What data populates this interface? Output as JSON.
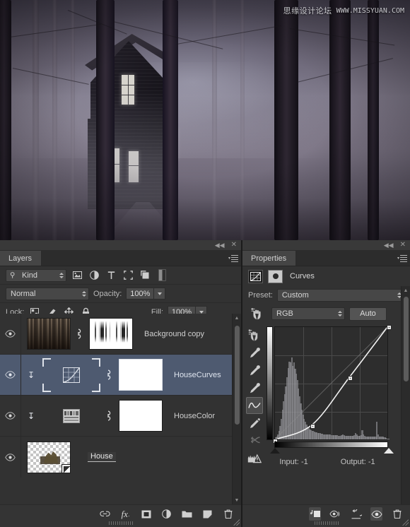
{
  "canvas": {
    "watermark_cn": "思缘设计论坛",
    "watermark_url": "WWW.MISSYUAN.COM",
    "scene_description": "Dark haunted wooden house in a foggy forest with bare tree trunks",
    "colors": {
      "sky": "#7e7888",
      "fog": "#a6a4b4",
      "house": "#1d1a22",
      "window": "#d6d3cc"
    }
  },
  "layers_panel": {
    "title": "Layers",
    "topbar": {
      "collapse_icon": "collapse-double-arrow-icon",
      "close_icon": "close-icon",
      "menu_icon": "panel-menu-icon"
    },
    "filter": {
      "kind_label": "Kind",
      "search_icon": "search-icon",
      "type_filters": [
        "pixel-layer-filter-icon",
        "adjustment-layer-filter-icon",
        "type-layer-filter-icon",
        "shape-layer-filter-icon",
        "smart-object-filter-icon"
      ],
      "toggle_icon": "filter-enable-toggle"
    },
    "blend": {
      "mode": "Normal",
      "opacity_label": "Opacity:",
      "opacity_value": "100%"
    },
    "lock": {
      "label": "Lock:",
      "icons": [
        "lock-transparent-pixels-icon",
        "lock-image-pixels-icon",
        "lock-position-icon",
        "lock-all-icon"
      ],
      "fill_label": "Fill:",
      "fill_value": "100%"
    },
    "layers": [
      {
        "name": "Background copy",
        "visible": true,
        "selected": false,
        "thumb_type": "forest",
        "has_mask": true,
        "mask_type": "strokes",
        "linked": true,
        "editing": false,
        "clipped": false
      },
      {
        "name": "HouseCurves",
        "visible": true,
        "selected": true,
        "thumb_type": "adjustment-curves",
        "has_mask": true,
        "mask_type": "white",
        "linked": true,
        "editing": false,
        "clipped": true
      },
      {
        "name": "HouseColor",
        "visible": true,
        "selected": false,
        "thumb_type": "adjustment-color-balance",
        "has_mask": true,
        "mask_type": "white",
        "linked": true,
        "editing": false,
        "clipped": true
      },
      {
        "name": "House",
        "visible": true,
        "selected": false,
        "thumb_type": "checker-house",
        "has_mask": false,
        "mask_type": "",
        "linked": false,
        "editing": true,
        "clipped": false
      }
    ],
    "bottom_icons": [
      "link-layers-icon",
      "add-layer-style-icon",
      "add-layer-mask-icon",
      "new-adjustment-layer-icon",
      "new-group-icon",
      "new-layer-icon",
      "delete-layer-icon"
    ],
    "scrollbar": {
      "up_arrow": "scroll-up-arrow",
      "down_arrow": "scroll-down-arrow"
    }
  },
  "properties_panel": {
    "title": "Properties",
    "topbar": {
      "collapse_icon": "collapse-double-arrow-icon",
      "close_icon": "close-icon",
      "menu_icon": "panel-menu-icon"
    },
    "adjustment_title": "Curves",
    "adjustment_icon": "curves-icon",
    "mask_icon": "pixel-mask-icon",
    "preset": {
      "label": "Preset:",
      "value": "Custom"
    },
    "channel": {
      "value": "RGB",
      "auto_label": "Auto",
      "targeted_adjust_icon": "on-image-adjust-icon"
    },
    "tools": [
      "on-image-adjustment-tool-icon",
      "black-point-eyedropper-icon",
      "gray-point-eyedropper-icon",
      "white-point-eyedropper-icon",
      "curve-point-tool-icon",
      "pencil-draw-curve-icon",
      "smooth-curve-icon",
      "clipping-warning-icon"
    ],
    "active_tool": "curve-point-tool-icon",
    "readout": {
      "input_label": "Input:",
      "input_value": "-1",
      "output_label": "Output:",
      "output_value": "-1"
    },
    "bottom_icons": [
      "clip-to-layer-icon",
      "toggle-layer-mask-icon",
      "reset-adjustment-icon",
      "toggle-layer-visibility-icon",
      "delete-adjustment-layer-icon"
    ],
    "active_bottom_icon": "clip-to-layer-icon"
  },
  "chart_data": {
    "type": "line",
    "title": "Curves (RGB)",
    "xlabel": "Input",
    "ylabel": "Output",
    "xlim": [
      0,
      255
    ],
    "ylim": [
      0,
      255
    ],
    "grid": true,
    "legend": "none",
    "gradient_bars": {
      "input_axis": "black-to-white-horizontal",
      "output_axis": "black-to-white-vertical"
    },
    "control_points": [
      {
        "input": 0,
        "output": 0
      },
      {
        "input": 84,
        "output": 33
      },
      {
        "input": 168,
        "output": 140
      },
      {
        "input": 255,
        "output": 255
      }
    ],
    "baseline": {
      "from": [
        0,
        0
      ],
      "to": [
        255,
        255
      ]
    },
    "endpoint_sliders": {
      "black_point": 0,
      "white_point": 255
    },
    "histogram_note": "Shadow-heavy histogram with a large peak near input 30-60 and small spikes near 195-225",
    "histogram": [
      4,
      6,
      10,
      16,
      26,
      40,
      58,
      74,
      88,
      104,
      122,
      140,
      152,
      150,
      160,
      143,
      150,
      138,
      128,
      116,
      100,
      84,
      70,
      58,
      48,
      40,
      34,
      29,
      25,
      22,
      20,
      18,
      17,
      16,
      15,
      14,
      14,
      13,
      12,
      12,
      11,
      11,
      10,
      10,
      10,
      9,
      9,
      9,
      9,
      8,
      8,
      8,
      8,
      8,
      8,
      7,
      7,
      7,
      8,
      10,
      8,
      7,
      7,
      7,
      7,
      7,
      7,
      7,
      7,
      8,
      12,
      9,
      7,
      7,
      7,
      8,
      18,
      10,
      7,
      6,
      6,
      6,
      6,
      6,
      6,
      6,
      6,
      6,
      6,
      34,
      10,
      6,
      5,
      5,
      5,
      4,
      4,
      3,
      2,
      1
    ]
  }
}
